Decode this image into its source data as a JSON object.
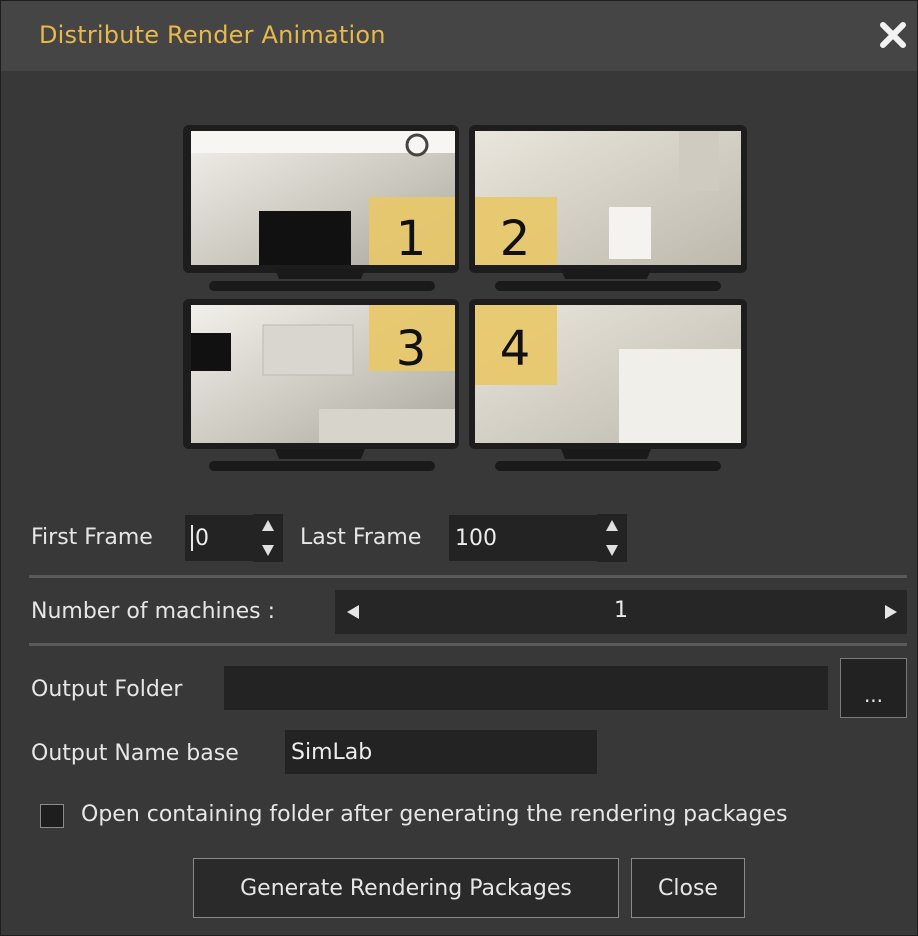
{
  "window": {
    "title": "Distribute Render Animation"
  },
  "preview": {
    "monitor_numbers": [
      "1",
      "2",
      "3",
      "4"
    ],
    "highlight_color": "#e8c86a"
  },
  "frames": {
    "first_label": "First Frame",
    "first_value": "0",
    "last_label": "Last Frame",
    "last_value": "100"
  },
  "machines": {
    "label": "Number of machines :",
    "value": "1"
  },
  "output": {
    "folder_label": "Output Folder",
    "folder_value": "",
    "browse_label": "...",
    "name_label": "Output Name base",
    "name_value": "SimLab"
  },
  "options": {
    "open_folder_label": "Open containing folder after generating the rendering packages",
    "open_folder_checked": false
  },
  "buttons": {
    "generate": "Generate Rendering Packages",
    "close": "Close"
  },
  "colors": {
    "accent": "#e8b84a",
    "background": "#383838",
    "field": "#232323"
  }
}
